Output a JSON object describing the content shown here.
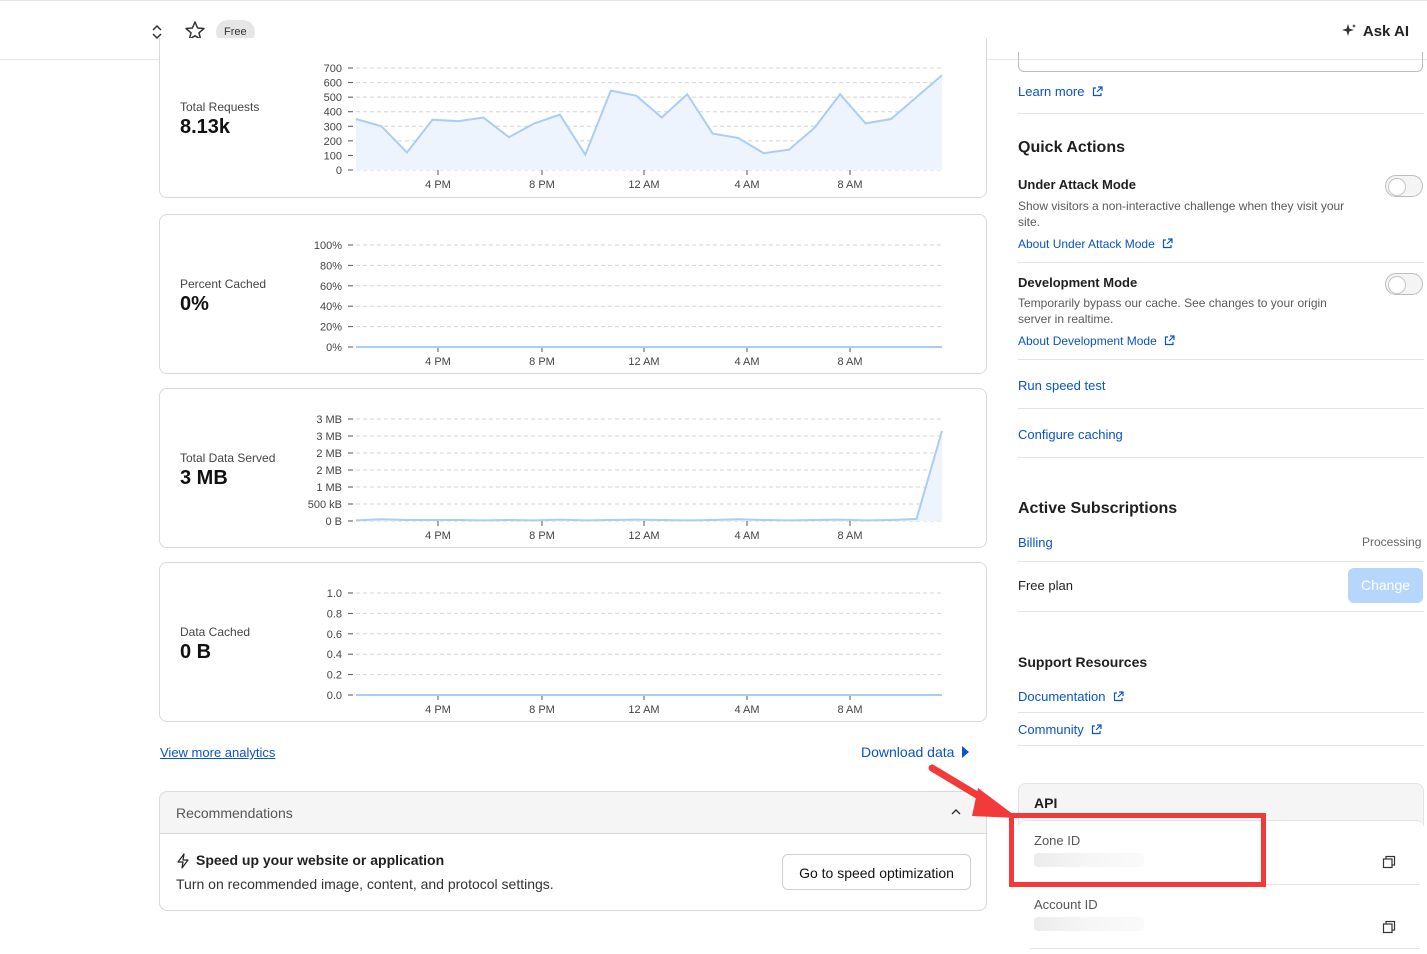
{
  "topbar": {
    "badge": "Free",
    "ask_ai": "Ask AI"
  },
  "charts": [
    {
      "label": "Total Requests",
      "value": "8.13k",
      "chart_data": {
        "type": "area",
        "y_ticks": [
          "700",
          "600",
          "500",
          "400",
          "300",
          "200",
          "100",
          "0"
        ],
        "ylim": [
          0,
          700
        ],
        "x_ticks": [
          "4 PM",
          "8 PM",
          "12 AM",
          "4 AM",
          "8 AM"
        ],
        "values": [
          350,
          300,
          120,
          345,
          335,
          360,
          225,
          320,
          380,
          105,
          545,
          510,
          360,
          520,
          250,
          220,
          115,
          140,
          290,
          520,
          320,
          350,
          500,
          650
        ]
      }
    },
    {
      "label": "Percent Cached",
      "value": "0%",
      "chart_data": {
        "type": "area",
        "y_ticks": [
          "100%",
          "80%",
          "60%",
          "40%",
          "20%",
          "0%"
        ],
        "ylim": [
          0,
          100
        ],
        "x_ticks": [
          "4 PM",
          "8 PM",
          "12 AM",
          "4 AM",
          "8 AM"
        ],
        "values": [
          0,
          0,
          0,
          0,
          0,
          0,
          0,
          0,
          0,
          0,
          0,
          0,
          0,
          0,
          0,
          0,
          0,
          0,
          0,
          0,
          0,
          0,
          0,
          0
        ]
      }
    },
    {
      "label": "Total Data Served",
      "value": "3 MB",
      "chart_data": {
        "type": "area",
        "y_ticks": [
          "3 MB",
          "3 MB",
          "2 MB",
          "2 MB",
          "1 MB",
          "500 kB",
          "0 B"
        ],
        "ylim": [
          0,
          3
        ],
        "x_ticks": [
          "4 PM",
          "8 PM",
          "12 AM",
          "4 AM",
          "8 AM"
        ],
        "values": [
          0.02,
          0.05,
          0.03,
          0.03,
          0.03,
          0.02,
          0.03,
          0.02,
          0.04,
          0.02,
          0.03,
          0.04,
          0.03,
          0.02,
          0.03,
          0.05,
          0.03,
          0.02,
          0.03,
          0.04,
          0.02,
          0.03,
          0.06,
          2.65
        ]
      }
    },
    {
      "label": "Data Cached",
      "value": "0 B",
      "chart_data": {
        "type": "area",
        "y_ticks": [
          "1.0",
          "0.8",
          "0.6",
          "0.4",
          "0.2",
          "0.0"
        ],
        "ylim": [
          0,
          1
        ],
        "x_ticks": [
          "4 PM",
          "8 PM",
          "12 AM",
          "4 AM",
          "8 AM"
        ],
        "values": [
          0,
          0,
          0,
          0,
          0,
          0,
          0,
          0,
          0,
          0,
          0,
          0,
          0,
          0,
          0,
          0,
          0,
          0,
          0,
          0,
          0,
          0,
          0,
          0
        ]
      }
    }
  ],
  "links": {
    "view_more": "View more analytics",
    "download": "Download data"
  },
  "recommendations": {
    "header": "Recommendations",
    "title": "Speed up your website or application",
    "desc": "Turn on recommended image, content, and protocol settings.",
    "button": "Go to speed optimization"
  },
  "right": {
    "learn_more": "Learn more",
    "quick_actions": "Quick Actions",
    "under_attack": {
      "title": "Under Attack Mode",
      "desc": "Show visitors a non-interactive challenge when they visit your site.",
      "link": "About Under Attack Mode"
    },
    "dev_mode": {
      "title": "Development Mode",
      "desc": "Temporarily bypass our cache. See changes to your origin server in realtime.",
      "link": "About Development Mode"
    },
    "speed_test": "Run speed test",
    "configure_caching": "Configure caching",
    "subscriptions": {
      "title": "Active Subscriptions",
      "billing": "Billing",
      "status": "Processing",
      "plan": "Free plan",
      "change": "Change"
    },
    "support": {
      "title": "Support Resources",
      "docs": "Documentation",
      "community": "Community"
    },
    "api": {
      "title": "API",
      "zone_id": "Zone ID",
      "account_id": "Account ID"
    }
  },
  "colors": {
    "accent": "#0a53c8",
    "chart_line": "#a9cdf6",
    "chart_fill": "#eef4fd",
    "highlight": "#f23a3a"
  }
}
